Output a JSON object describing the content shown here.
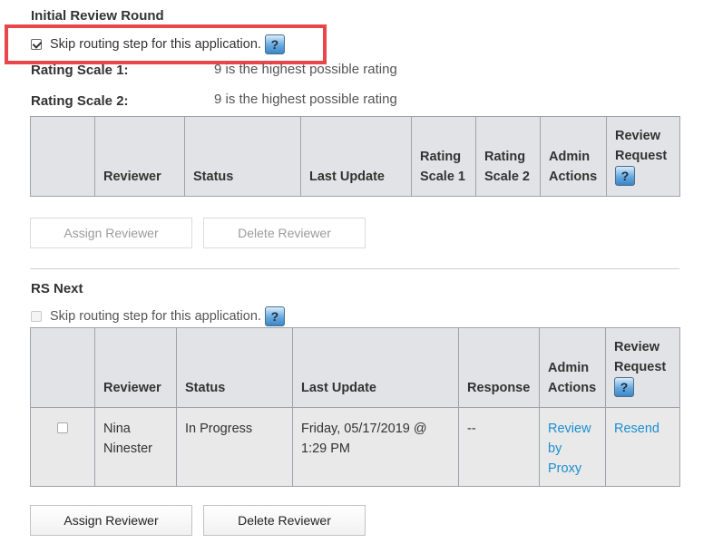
{
  "initial_round": {
    "title": "Initial Review Round",
    "skip_label": "Skip routing step for this application.",
    "skip_checked": true,
    "help_label": "?",
    "rating_scale_1_label": "Rating Scale 1:",
    "rating_scale_1_value": "9 is the highest possible rating",
    "rating_scale_2_label": "Rating Scale 2:",
    "rating_scale_2_value": "9 is the highest possible rating",
    "columns": {
      "select": "",
      "reviewer": "Reviewer",
      "status": "Status",
      "last_update": "Last Update",
      "rating_scale_1": "Rating Scale 1",
      "rating_scale_2": "Rating Scale 2",
      "admin_actions": "Admin Actions",
      "review_request": "Review Request"
    },
    "assign_label": "Assign Reviewer",
    "delete_label": "Delete Reviewer"
  },
  "rs_next": {
    "title": "RS Next",
    "skip_label": "Skip routing step for this application.",
    "skip_checked": false,
    "help_label": "?",
    "columns": {
      "select": "",
      "reviewer": "Reviewer",
      "status": "Status",
      "last_update": "Last Update",
      "response": "Response",
      "admin_actions": "Admin Actions",
      "review_request": "Review Request"
    },
    "rows": [
      {
        "reviewer": "Nina Ninester",
        "status": "In Progress",
        "last_update": "Friday, 05/17/2019 @ 1:29 PM",
        "response": "--",
        "admin_action": "Review by Proxy",
        "review_request": "Resend"
      }
    ],
    "assign_label": "Assign Reviewer",
    "delete_label": "Delete Reviewer"
  },
  "colors": {
    "highlight": "#e8464b",
    "link": "#1a8fd1",
    "header_bg": "#e2e3e6"
  }
}
